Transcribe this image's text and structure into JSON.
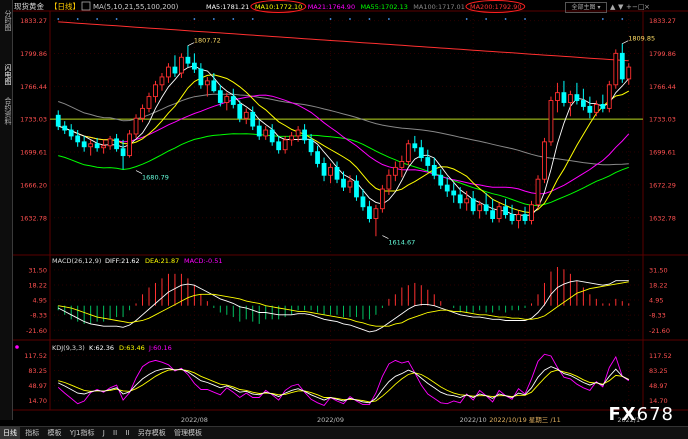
{
  "sidebar": {
    "tabs": [
      "分时图",
      "闪电图",
      "合约资料"
    ],
    "active_tab": "闪电图"
  },
  "window": {
    "dropdown_label": "全部主图",
    "buttons": [
      "▲",
      "▼",
      "+",
      "−",
      "□",
      "×"
    ]
  },
  "header": {
    "symbol": "现货黄金",
    "period": "【日线】",
    "ma_params": "MA(5,10,21,55,100,200)",
    "items": [
      {
        "label": "MA5:1781.21",
        "color": "#ffffff",
        "circled": false
      },
      {
        "label": "MA10:1772.10",
        "color": "#ffff00",
        "circled": true
      },
      {
        "label": "MA21:1764.90",
        "color": "#ff00ff",
        "circled": false
      },
      {
        "label": "MA55:1702.13",
        "color": "#00ff00",
        "circled": false
      },
      {
        "label": "MA100:1717.01",
        "color": "#888888",
        "circled": false
      },
      {
        "label": "MA200:1792.90",
        "color": "#ff3030",
        "circled": true
      }
    ]
  },
  "macd_header": {
    "params": "MACD(26,12,9)",
    "diff": "DIFF:21.62",
    "dea": "DEA:21.87",
    "macd": "MACD:-0.51"
  },
  "kdj_header": {
    "params": "KDJ(9,3,3)",
    "k": "K:62.36",
    "d": "D:63.46",
    "j": "J:60.16"
  },
  "bottom_tabs": [
    "日线",
    "指标",
    "模板",
    "YJ1指标",
    "J",
    "II",
    "II",
    "另存模板",
    "管理模板"
  ],
  "active_bottom_tab": "日线",
  "watermark": {
    "fx": "FX",
    "num": "678"
  },
  "chart_data": {
    "type": "candlestick",
    "colors": {
      "up": "#ff3030",
      "down": "#00ffff",
      "ma5": "#ffffff",
      "ma10": "#ffff00",
      "ma21": "#ff00ff",
      "ma55": "#00ff00",
      "ma100": "#888888",
      "ma200": "#ff3030",
      "hline": "#b8d820"
    },
    "main": {
      "ylim": [
        1600,
        1840
      ],
      "yticks": [
        1833.27,
        1799.86,
        1766.44,
        1733.03,
        1699.61,
        1666.2,
        1632.78
      ],
      "right_ticks": [
        "1833.27",
        "1799.86",
        "1766.44",
        "1733.03",
        "1699.61",
        "1672.29",
        "1632.78"
      ],
      "horizontal_line": 1733.03,
      "annotations": [
        {
          "text": "1807.72",
          "index": 20,
          "value": 1807.72
        },
        {
          "text": "1680.79",
          "index": 12,
          "value": 1680.79
        },
        {
          "text": "1614.67",
          "index": 50,
          "value": 1614.67
        },
        {
          "text": "1809.85",
          "index": 87,
          "value": 1809.85
        }
      ]
    },
    "x_labels": [
      {
        "text": "2022/08",
        "index": 21
      },
      {
        "text": "2022/09",
        "index": 42
      },
      {
        "text": "2022/10",
        "index": 64
      },
      {
        "text": "2022/10/19 星期三 /11",
        "index": 72,
        "highlight": true
      },
      {
        "text": "2022/1",
        "index": 88
      }
    ],
    "ohlc": [
      [
        1737,
        1742,
        1722,
        1726
      ],
      [
        1726,
        1731,
        1718,
        1722
      ],
      [
        1722,
        1728,
        1712,
        1716
      ],
      [
        1716,
        1722,
        1705,
        1710
      ],
      [
        1710,
        1716,
        1700,
        1705
      ],
      [
        1705,
        1712,
        1696,
        1708
      ],
      [
        1708,
        1714,
        1700,
        1704
      ],
      [
        1704,
        1712,
        1698,
        1706
      ],
      [
        1706,
        1716,
        1702,
        1713
      ],
      [
        1713,
        1718,
        1700,
        1703
      ],
      [
        1703,
        1712,
        1682,
        1696
      ],
      [
        1696,
        1722,
        1694,
        1718
      ],
      [
        1718,
        1738,
        1714,
        1734
      ],
      [
        1734,
        1748,
        1730,
        1744
      ],
      [
        1744,
        1760,
        1740,
        1756
      ],
      [
        1756,
        1772,
        1750,
        1768
      ],
      [
        1768,
        1780,
        1762,
        1776
      ],
      [
        1776,
        1790,
        1770,
        1786
      ],
      [
        1786,
        1798,
        1776,
        1780
      ],
      [
        1780,
        1800,
        1775,
        1796
      ],
      [
        1796,
        1808,
        1786,
        1790
      ],
      [
        1790,
        1800,
        1780,
        1784
      ],
      [
        1784,
        1790,
        1764,
        1768
      ],
      [
        1768,
        1776,
        1756,
        1772
      ],
      [
        1772,
        1780,
        1760,
        1762
      ],
      [
        1762,
        1768,
        1746,
        1750
      ],
      [
        1750,
        1760,
        1742,
        1756
      ],
      [
        1756,
        1764,
        1744,
        1748
      ],
      [
        1748,
        1752,
        1730,
        1734
      ],
      [
        1734,
        1744,
        1728,
        1740
      ],
      [
        1740,
        1746,
        1722,
        1726
      ],
      [
        1726,
        1732,
        1712,
        1716
      ],
      [
        1716,
        1726,
        1712,
        1722
      ],
      [
        1722,
        1728,
        1706,
        1710
      ],
      [
        1710,
        1716,
        1698,
        1702
      ],
      [
        1702,
        1716,
        1698,
        1712
      ],
      [
        1712,
        1720,
        1706,
        1716
      ],
      [
        1716,
        1726,
        1710,
        1722
      ],
      [
        1722,
        1728,
        1708,
        1712
      ],
      [
        1712,
        1718,
        1696,
        1700
      ],
      [
        1700,
        1706,
        1684,
        1688
      ],
      [
        1688,
        1694,
        1670,
        1676
      ],
      [
        1676,
        1688,
        1668,
        1684
      ],
      [
        1684,
        1690,
        1668,
        1672
      ],
      [
        1672,
        1680,
        1660,
        1664
      ],
      [
        1664,
        1676,
        1658,
        1670
      ],
      [
        1670,
        1676,
        1650,
        1654
      ],
      [
        1654,
        1662,
        1640,
        1644
      ],
      [
        1644,
        1650,
        1628,
        1632
      ],
      [
        1632,
        1646,
        1614,
        1642
      ],
      [
        1642,
        1666,
        1638,
        1662
      ],
      [
        1662,
        1682,
        1656,
        1676
      ],
      [
        1676,
        1690,
        1670,
        1684
      ],
      [
        1684,
        1696,
        1674,
        1690
      ],
      [
        1690,
        1712,
        1686,
        1708
      ],
      [
        1708,
        1716,
        1700,
        1704
      ],
      [
        1704,
        1712,
        1690,
        1694
      ],
      [
        1694,
        1702,
        1680,
        1686
      ],
      [
        1686,
        1694,
        1672,
        1676
      ],
      [
        1676,
        1682,
        1662,
        1666
      ],
      [
        1666,
        1674,
        1654,
        1660
      ],
      [
        1660,
        1668,
        1648,
        1656
      ],
      [
        1656,
        1664,
        1642,
        1648
      ],
      [
        1648,
        1660,
        1640,
        1652
      ],
      [
        1652,
        1660,
        1636,
        1640
      ],
      [
        1640,
        1650,
        1632,
        1646
      ],
      [
        1646,
        1658,
        1636,
        1640
      ],
      [
        1640,
        1652,
        1628,
        1632
      ],
      [
        1632,
        1648,
        1628,
        1644
      ],
      [
        1644,
        1652,
        1632,
        1636
      ],
      [
        1636,
        1646,
        1626,
        1630
      ],
      [
        1630,
        1640,
        1622,
        1636
      ],
      [
        1636,
        1644,
        1626,
        1630
      ],
      [
        1630,
        1650,
        1626,
        1646
      ],
      [
        1646,
        1676,
        1642,
        1672
      ],
      [
        1672,
        1714,
        1668,
        1710
      ],
      [
        1710,
        1756,
        1706,
        1752
      ],
      [
        1752,
        1770,
        1740,
        1760
      ],
      [
        1760,
        1772,
        1746,
        1750
      ],
      [
        1750,
        1762,
        1736,
        1758
      ],
      [
        1758,
        1770,
        1748,
        1752
      ],
      [
        1752,
        1764,
        1742,
        1746
      ],
      [
        1746,
        1756,
        1734,
        1740
      ],
      [
        1740,
        1752,
        1736,
        1748
      ],
      [
        1748,
        1758,
        1740,
        1744
      ],
      [
        1744,
        1772,
        1740,
        1768
      ],
      [
        1768,
        1804,
        1764,
        1800
      ],
      [
        1800,
        1810,
        1770,
        1774
      ],
      [
        1774,
        1790,
        1768,
        1786
      ]
    ],
    "macd": {
      "ylim": [
        -24,
        34
      ],
      "ticks": [
        "31.50",
        "18.22",
        "4.95",
        "-8.33",
        "-21.60"
      ],
      "tick_values": [
        31.5,
        18.22,
        4.95,
        -8.33,
        -21.6
      ],
      "diff": [
        -2,
        -5,
        -8,
        -11,
        -14,
        -16,
        -17,
        -18,
        -18,
        -18,
        -19,
        -17,
        -13,
        -8,
        -3,
        2,
        7,
        12,
        15,
        18,
        19,
        18,
        15,
        12,
        9,
        6,
        4,
        2,
        -1,
        -2,
        -4,
        -6,
        -6,
        -7,
        -8,
        -8,
        -8,
        -7,
        -7,
        -8,
        -10,
        -12,
        -13,
        -14,
        -16,
        -17,
        -19,
        -21,
        -23,
        -22,
        -19,
        -15,
        -11,
        -7,
        -3,
        0,
        1,
        1,
        0,
        -2,
        -4,
        -6,
        -8,
        -9,
        -10,
        -10,
        -11,
        -12,
        -12,
        -13,
        -13,
        -13,
        -13,
        -11,
        -6,
        1,
        10,
        16,
        19,
        21,
        22,
        21,
        20,
        19,
        18,
        19,
        22,
        22,
        22
      ],
      "dea": [
        0,
        -1,
        -2,
        -4,
        -6,
        -8,
        -10,
        -11,
        -12,
        -13,
        -14,
        -15,
        -14,
        -13,
        -11,
        -8,
        -5,
        -2,
        1,
        4,
        7,
        9,
        10,
        10,
        10,
        9,
        8,
        7,
        6,
        4,
        3,
        2,
        0,
        -1,
        -2,
        -3,
        -4,
        -5,
        -5,
        -6,
        -7,
        -8,
        -9,
        -10,
        -11,
        -12,
        -14,
        -15,
        -17,
        -18,
        -18,
        -18,
        -16,
        -15,
        -12,
        -10,
        -8,
        -6,
        -5,
        -4,
        -4,
        -5,
        -5,
        -6,
        -7,
        -8,
        -8,
        -9,
        -10,
        -10,
        -11,
        -11,
        -12,
        -12,
        -11,
        -9,
        -5,
        -1,
        3,
        7,
        11,
        13,
        15,
        16,
        17,
        18,
        19,
        20,
        21
      ]
    },
    "kdj": {
      "ylim": [
        5,
        125
      ],
      "ticks": [
        "117.52",
        "83.25",
        "48.97",
        "14.70"
      ],
      "tick_values": [
        117.52,
        83.25,
        48.97,
        14.7
      ],
      "k": [
        55,
        48,
        40,
        32,
        30,
        35,
        38,
        36,
        40,
        44,
        30,
        35,
        50,
        64,
        74,
        82,
        86,
        88,
        84,
        86,
        80,
        70,
        60,
        56,
        50,
        44,
        48,
        42,
        34,
        36,
        30,
        28,
        34,
        30,
        24,
        32,
        38,
        42,
        36,
        28,
        22,
        16,
        22,
        18,
        14,
        20,
        16,
        12,
        10,
        20,
        40,
        58,
        70,
        76,
        84,
        78,
        66,
        54,
        44,
        34,
        28,
        26,
        22,
        28,
        22,
        30,
        26,
        20,
        30,
        26,
        22,
        32,
        28,
        44,
        68,
        84,
        92,
        86,
        76,
        72,
        64,
        56,
        50,
        56,
        50,
        70,
        86,
        70,
        62
      ],
      "d": [
        60,
        56,
        50,
        44,
        38,
        36,
        37,
        37,
        38,
        41,
        37,
        36,
        42,
        50,
        60,
        70,
        78,
        84,
        85,
        85,
        83,
        78,
        70,
        64,
        58,
        52,
        50,
        46,
        40,
        38,
        34,
        31,
        32,
        31,
        28,
        29,
        33,
        37,
        37,
        33,
        28,
        22,
        22,
        20,
        17,
        18,
        17,
        15,
        12,
        14,
        25,
        38,
        52,
        64,
        74,
        78,
        74,
        66,
        56,
        46,
        38,
        32,
        28,
        27,
        25,
        26,
        26,
        24,
        26,
        26,
        24,
        27,
        27,
        34,
        50,
        66,
        80,
        84,
        80,
        76,
        70,
        62,
        56,
        55,
        52,
        60,
        72,
        70,
        63
      ],
      "j": [
        45,
        32,
        20,
        8,
        14,
        33,
        40,
        34,
        44,
        50,
        16,
        33,
        66,
        92,
        102,
        106,
        102,
        96,
        82,
        88,
        74,
        54,
        40,
        40,
        34,
        28,
        44,
        34,
        22,
        32,
        22,
        22,
        38,
        28,
        16,
        38,
        48,
        52,
        34,
        18,
        10,
        4,
        22,
        14,
        8,
        24,
        14,
        6,
        6,
        32,
        70,
        98,
        106,
        100,
        104,
        78,
        50,
        30,
        20,
        10,
        8,
        14,
        10,
        30,
        16,
        38,
        26,
        12,
        38,
        26,
        18,
        42,
        30,
        64,
        104,
        120,
        116,
        90,
        68,
        64,
        52,
        44,
        38,
        58,
        46,
        90,
        114,
        70,
        60
      ]
    }
  }
}
